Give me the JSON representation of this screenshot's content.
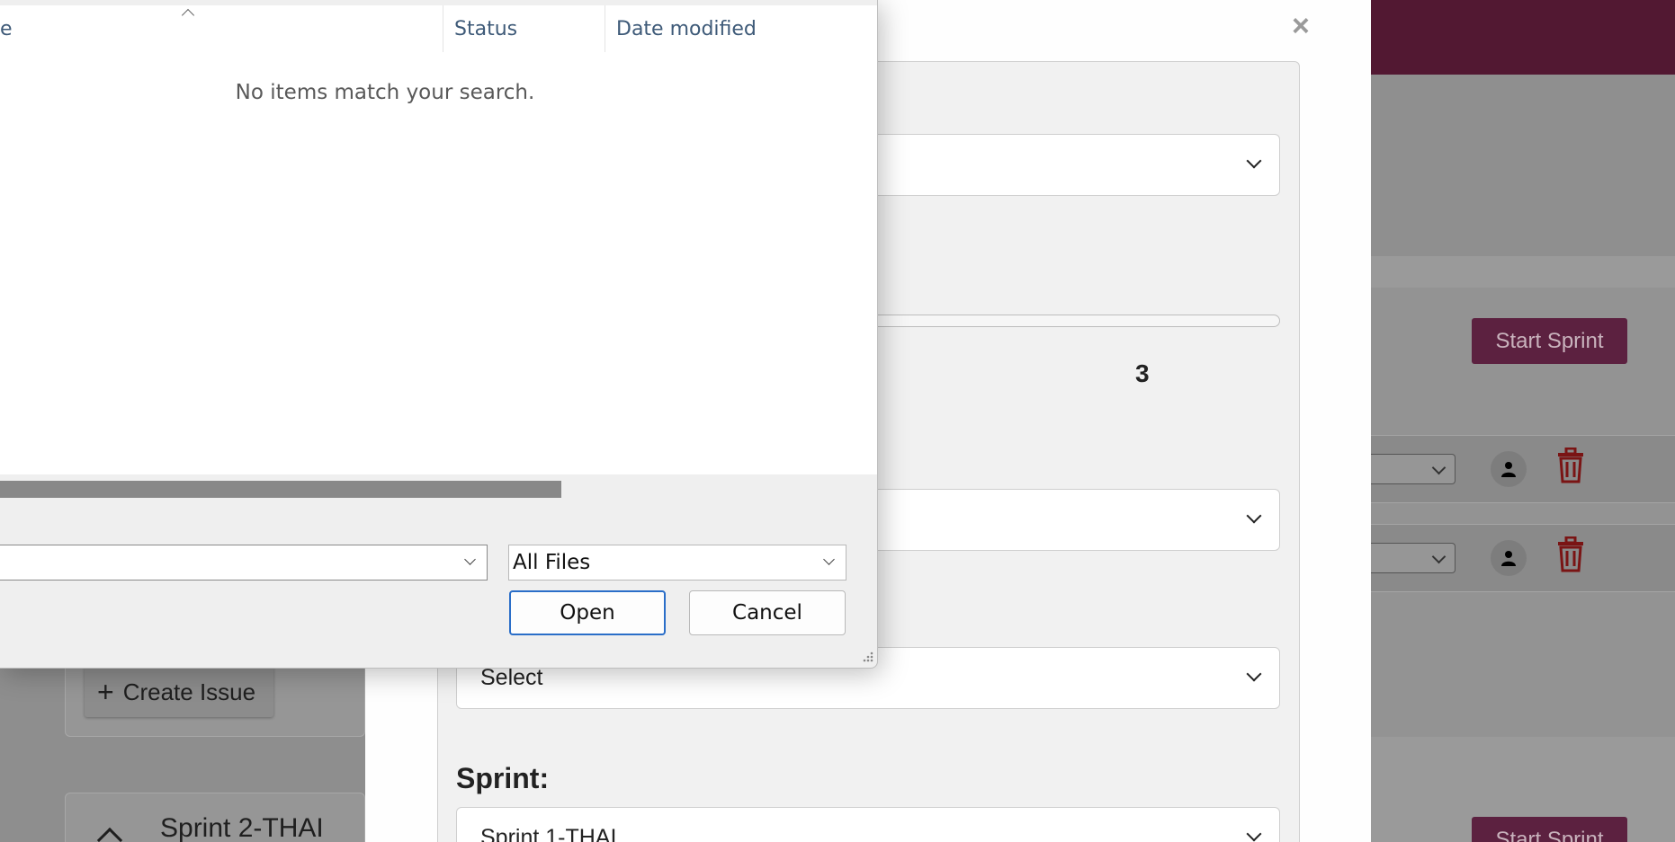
{
  "background_app": {
    "sprint1_start_button": "Start Sprint",
    "sprint2_start_button": "Start Sprint",
    "create_issue_label": "Create Issue",
    "sprint2_title": "Sprint 2-THAI"
  },
  "modal": {
    "close_symbol": "×",
    "range_value": "3",
    "assignee_select_value": "Select",
    "sprint_label": "Sprint:",
    "sprint_select_value": "Sprint 1-THAI"
  },
  "file_dialog": {
    "columns": {
      "name_partial": "e",
      "status": "Status",
      "date_modified": "Date modified"
    },
    "empty_message": "No items match your search.",
    "file_type_value": "All Files",
    "open_button": "Open",
    "cancel_button": "Cancel"
  },
  "colors": {
    "brand_topbar": "#521832",
    "start_sprint_button": "#5c2140",
    "trash_icon": "#7a1414",
    "dialog_focus_border": "#2a6ec8"
  }
}
